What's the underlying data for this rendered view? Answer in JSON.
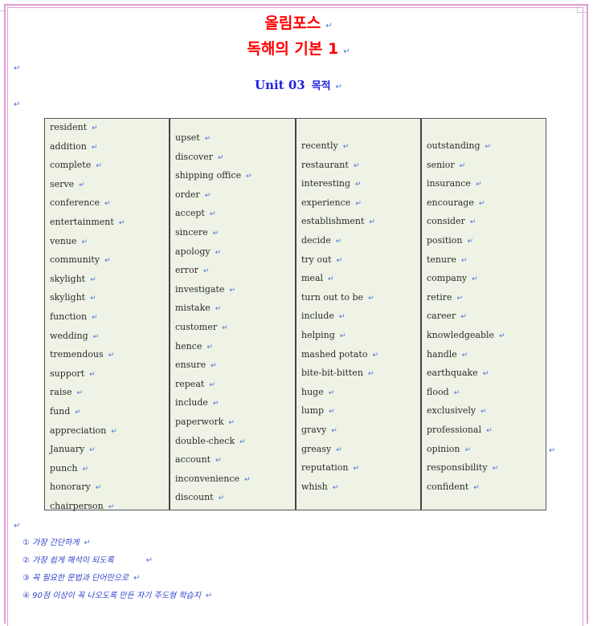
{
  "header": {
    "title_line1": "올림포스",
    "title_line2": "독해의 기본 1",
    "unit_label": "Unit 03",
    "unit_topic": "목적",
    "paragraph_mark": "↵"
  },
  "colors": {
    "title": "#ff0000",
    "unit_title": "#2222dd",
    "page_border": "#e59ad3",
    "table_background": "#eef3e6",
    "notes_text": "#3344cc",
    "paragraph_mark": "#4a6fd8"
  },
  "vocabulary": {
    "columns": [
      {
        "words": [
          "resident",
          "addition",
          "complete",
          "serve",
          "conference",
          "entertainment",
          "venue",
          "community",
          "skylight",
          "skylight",
          "function",
          "wedding",
          "tremendous",
          "support",
          "raise",
          "fund",
          "appreciation",
          "January",
          "punch",
          "honorary",
          "chairperson"
        ]
      },
      {
        "words": [
          "upset",
          "discover",
          "shipping office",
          "order",
          "accept",
          "sincere",
          "apology",
          "error",
          "investigate",
          "mistake",
          "customer",
          "hence",
          "ensure",
          "repeat",
          "include",
          "paperwork",
          "double-check",
          "account",
          "inconvenience",
          "discount"
        ]
      },
      {
        "words": [
          "recently",
          "restaurant",
          "interesting",
          "experience",
          "establishment",
          "decide",
          "try out",
          "meal",
          "turn out to be",
          "include",
          "helping",
          "mashed potato",
          "bite-bit-bitten",
          "huge",
          "lump",
          "gravy",
          "greasy",
          "reputation",
          "whish"
        ]
      },
      {
        "words": [
          "outstanding",
          "senior",
          "insurance",
          "encourage",
          "consider",
          "position",
          "tenure",
          "company",
          "retire",
          "career",
          "knowledgeable",
          "handle",
          "earthquake",
          "flood",
          "exclusively",
          "professional",
          "opinion",
          "responsibility",
          "confident"
        ]
      }
    ]
  },
  "notes": [
    "① 가장 간단하게",
    "② 가장 쉽게 해석이 되도록",
    "③ 꼭 필요한 문법과 단어만으로",
    "④ 90점 이상이 꼭 나오도록 만든 자기 주도형 학습지"
  ]
}
